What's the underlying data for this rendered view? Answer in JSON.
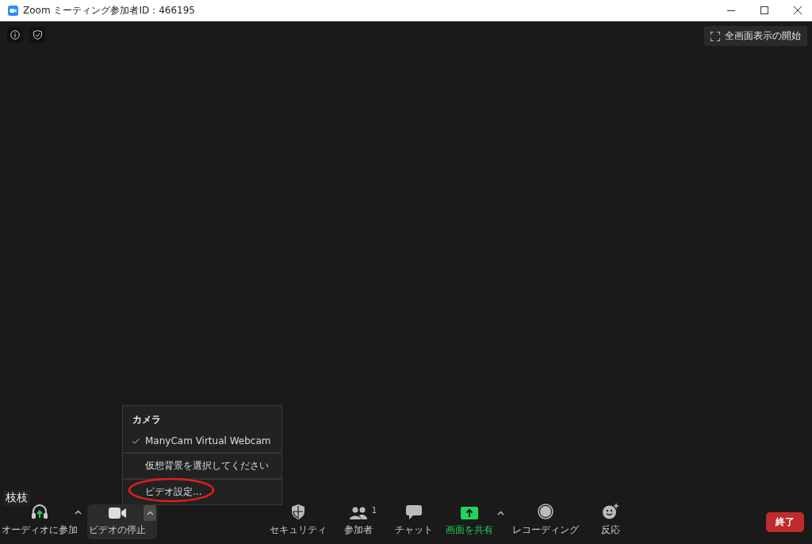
{
  "window": {
    "title": "Zoom ミーティング参加者ID：466195"
  },
  "fullscreen_button": "全画面表示の開始",
  "participant_name": "枝枝",
  "camera_menu": {
    "heading": "カメラ",
    "sections": [
      {
        "items": [
          {
            "label": "ManyCam Virtual Webcam",
            "checked": true,
            "circled": false
          }
        ]
      },
      {
        "items": [
          {
            "label": "仮想背景を選択してください",
            "checked": false,
            "circled": false
          }
        ]
      },
      {
        "items": [
          {
            "label": "ビデオ設定...",
            "checked": false,
            "circled": true
          }
        ]
      }
    ]
  },
  "toolbar": {
    "left": [
      {
        "kind": "audio",
        "label": "オーディオに参加",
        "expanded": false
      },
      {
        "kind": "video",
        "label": "ビデオの停止",
        "expanded": true
      }
    ],
    "center": [
      {
        "kind": "security",
        "label": "セキュリティ"
      },
      {
        "kind": "participants",
        "label": "参加者",
        "count": "1"
      },
      {
        "kind": "chat",
        "label": "チャット"
      },
      {
        "kind": "share",
        "label": "画面を共有"
      },
      {
        "kind": "record",
        "label": "レコーディング"
      },
      {
        "kind": "reactions",
        "label": "反応"
      }
    ],
    "end_button": "終了"
  }
}
